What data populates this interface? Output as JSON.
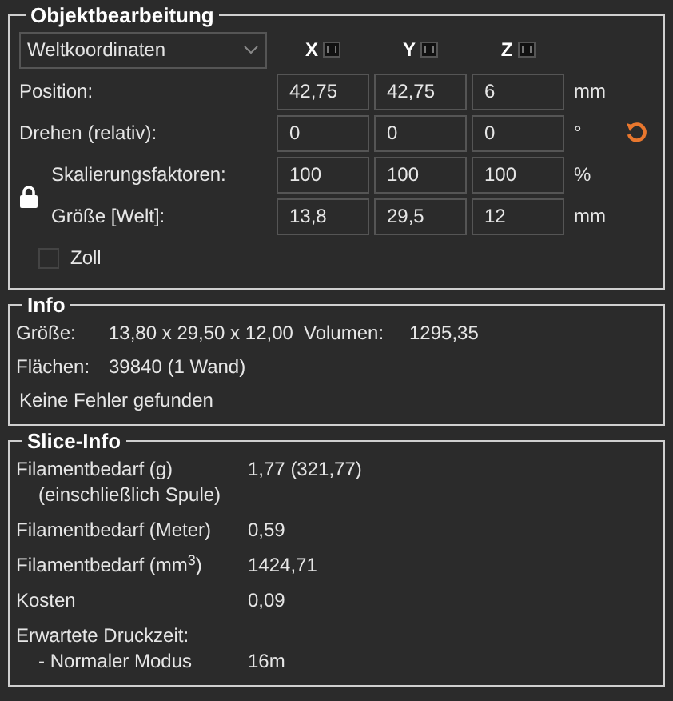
{
  "object_manipulation": {
    "title": "Objektbearbeitung",
    "coordinate_system": "Weltkoordinaten",
    "axes": [
      {
        "label": "X"
      },
      {
        "label": "Y"
      },
      {
        "label": "Z"
      }
    ],
    "rows": [
      {
        "kind": "plain",
        "label": "Position:",
        "values": [
          "42,75",
          "42,75",
          "6"
        ],
        "unit": "mm"
      },
      {
        "kind": "rotate",
        "label": "Drehen (relativ):",
        "values": [
          "0",
          "0",
          "0"
        ],
        "unit": "°"
      },
      {
        "kind": "scale",
        "label": "Skalierungsfaktoren:",
        "values": [
          "100",
          "100",
          "100"
        ],
        "unit": "%"
      },
      {
        "kind": "scale",
        "label": "Größe [Welt]:",
        "values": [
          "13,8",
          "29,5",
          "12"
        ],
        "unit": "mm"
      }
    ],
    "inches": {
      "label": "Zoll",
      "checked": false
    }
  },
  "info": {
    "title": "Info",
    "size_label": "Größe:",
    "size_value": "13,80 x 29,50 x 12,00",
    "volume_label": "Volumen:",
    "volume_value": "1295,35",
    "facets_label": "Flächen:",
    "facets_value": "39840 (1 Wand)",
    "status": "Keine Fehler gefunden"
  },
  "slice_info": {
    "title": "Slice-Info",
    "rows": [
      {
        "label": "Filamentbedarf (g)",
        "sublabel": "(einschließlich Spule)",
        "value": "1,77 (321,77)"
      },
      {
        "label": "Filamentbedarf (Meter)",
        "value": "0,59"
      },
      {
        "label": "Filamentbedarf (mm$^{3}$)",
        "value": "1424,71"
      },
      {
        "label": "Kosten",
        "value": "0,09"
      },
      {
        "label": "Erwartete Druckzeit:",
        "sublabel": "- Normaler Modus",
        "value": "16m"
      }
    ]
  }
}
